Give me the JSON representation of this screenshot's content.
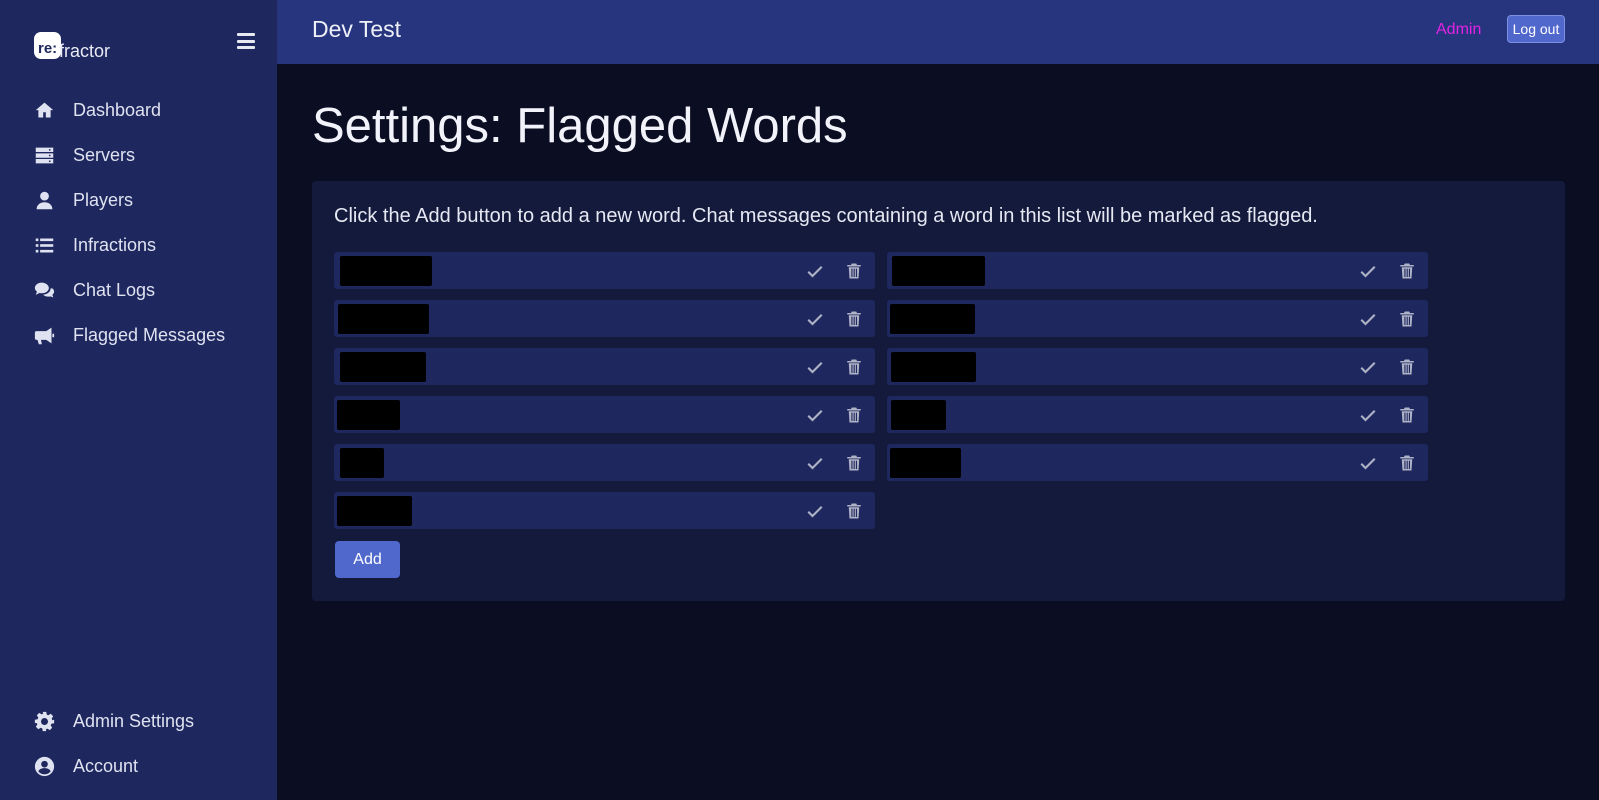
{
  "sidebar": {
    "brand_mark": "re:",
    "brand_text": "fractor",
    "items": [
      {
        "label": "Dashboard",
        "icon": "home-icon"
      },
      {
        "label": "Servers",
        "icon": "server-icon"
      },
      {
        "label": "Players",
        "icon": "user-icon"
      },
      {
        "label": "Infractions",
        "icon": "list-icon"
      },
      {
        "label": "Chat Logs",
        "icon": "chat-icon"
      },
      {
        "label": "Flagged Messages",
        "icon": "megaphone-icon"
      }
    ],
    "bottom_items": [
      {
        "label": "Admin Settings",
        "icon": "gear-icon"
      },
      {
        "label": "Account",
        "icon": "account-icon"
      }
    ]
  },
  "header": {
    "title": "Dev Test",
    "admin_link": "Admin",
    "logout_label": "Log out"
  },
  "main": {
    "page_title": "Settings: Flagged Words",
    "description": "Click the Add button to add a new word. Chat messages containing a word in this list will be marked as flagged.",
    "add_label": "Add",
    "words": [
      {
        "value": "",
        "redacted": true
      },
      {
        "value": "",
        "redacted": true
      },
      {
        "value": "",
        "redacted": true
      },
      {
        "value": "",
        "redacted": true
      },
      {
        "value": "",
        "redacted": true
      },
      {
        "value": "",
        "redacted": true
      },
      {
        "value": "",
        "redacted": true
      },
      {
        "value": "",
        "redacted": true
      },
      {
        "value": "",
        "redacted": true
      },
      {
        "value": "",
        "redacted": true
      },
      {
        "value": "",
        "redacted": true
      }
    ]
  },
  "colors": {
    "sidebar_bg": "#1e275e",
    "topbar_bg": "#27357f",
    "page_bg": "#0b0e22",
    "panel_bg": "#131a3c",
    "row_bg": "#1e275e",
    "accent": "#5068cc",
    "admin_link": "#e323e3"
  }
}
